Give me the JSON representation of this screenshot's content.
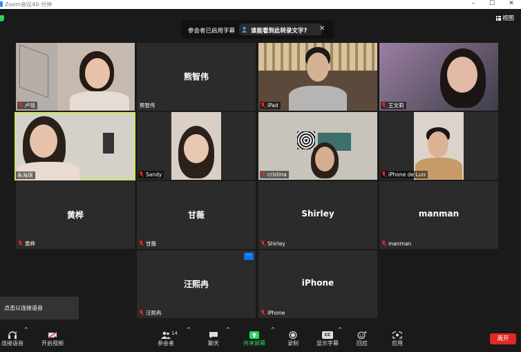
{
  "window": {
    "title": "Zoom会议40-分钟",
    "minimize": "–",
    "maximize": "☐",
    "close": "✕"
  },
  "top": {
    "caption_notice": "参会者已启用字幕",
    "caption_question": "谁能看到此转录文字?",
    "view_label": "视图"
  },
  "participants": [
    {
      "name": "卢瑶",
      "video": true
    },
    {
      "name": "熊智伟",
      "video": false
    },
    {
      "name": "iPad",
      "video": true
    },
    {
      "name": "王文莉",
      "video": true
    },
    {
      "name": "朱海琪",
      "video": true,
      "active_speaker": true
    },
    {
      "name": "Sandy",
      "video": true
    },
    {
      "name": "cristina",
      "video": true
    },
    {
      "name": "iPhone de Luis",
      "video": true
    },
    {
      "name": "黄桦",
      "video": false
    },
    {
      "name": "甘薇",
      "video": false
    },
    {
      "name": "Shirley",
      "video": false
    },
    {
      "name": "manman",
      "video": false
    },
    {
      "name": "汪熙冉",
      "video": false
    },
    {
      "name": "iPhone",
      "video": false
    }
  ],
  "more_button": "···",
  "tooltip": "点击以连接语音",
  "toolbar": {
    "audio": "连接语音",
    "video": "开启视频",
    "participants": "参会者",
    "participant_count": "14",
    "chat": "聊天",
    "share": "共享屏幕",
    "record": "录制",
    "captions": "显示字幕",
    "captions_icon": "CC",
    "reactions": "回应",
    "apps": "应用",
    "leave": "离开"
  },
  "colors": {
    "accent_green": "#23d959",
    "leave_red": "#e02828",
    "active_outline": "#c9e85a",
    "more_blue": "#0e72ed"
  }
}
